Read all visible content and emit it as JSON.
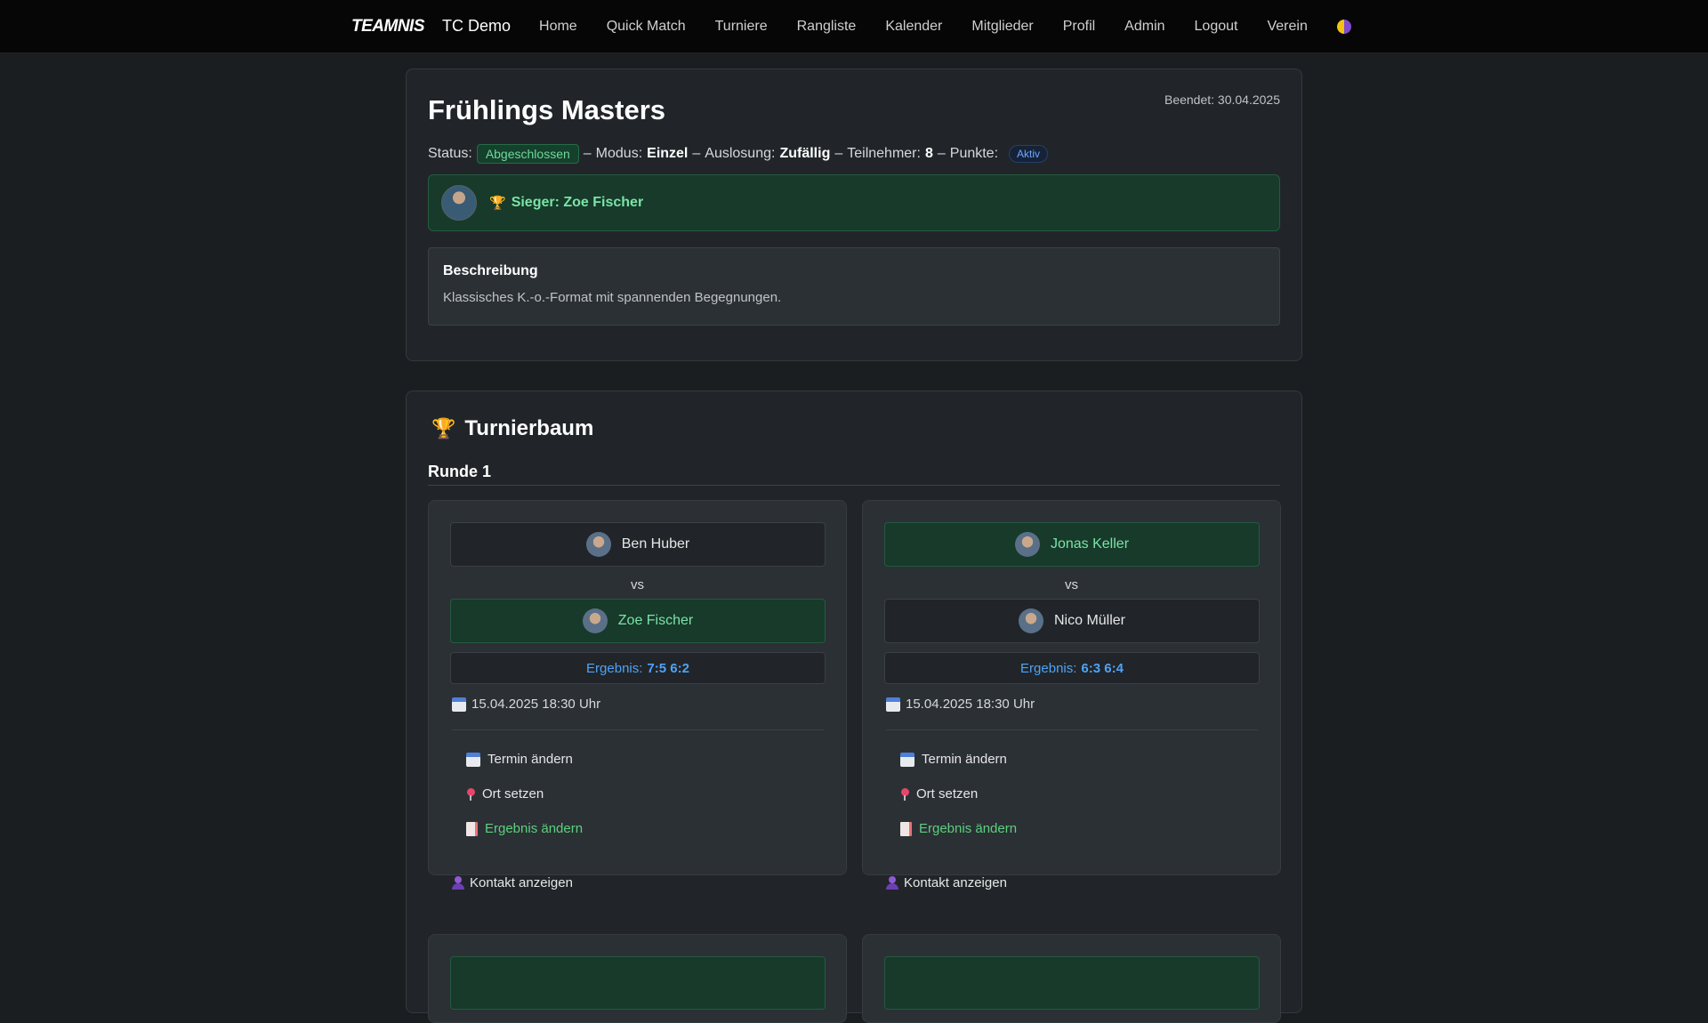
{
  "nav": {
    "logo_text": "TEAMNIS",
    "brand": "TC Demo",
    "items": [
      "Home",
      "Quick Match",
      "Turniere",
      "Rangliste",
      "Kalender",
      "Mitglieder",
      "Profil",
      "Admin",
      "Logout",
      "Verein"
    ]
  },
  "tournament": {
    "title": "Frühlings Masters",
    "ended": "Beendet: 30.04.2025",
    "status_label": "Status:",
    "status": "Abgeschlossen",
    "mode_label": "Modus:",
    "mode": "Einzel",
    "draw_label": "Auslosung:",
    "draw": "Zufällig",
    "participants_label": "Teilnehmer:",
    "participants": "8",
    "points_label": "Punkte:",
    "points_badge": "Aktiv",
    "separator": "–",
    "winner": "Sieger: Zoe Fischer",
    "description_title": "Beschreibung",
    "description": "Klassisches K.-o.-Format mit spannenden Begegnungen."
  },
  "tree": {
    "title": "Turnierbaum",
    "round": "Runde 1",
    "matches": [
      {
        "player1": "Ben Huber",
        "player2": "Zoe Fischer",
        "vs": "vs",
        "result_label": "Ergebnis:",
        "result": "7:5 6:2",
        "date": "15.04.2025 18:30 Uhr",
        "actions": [
          "Termin ändern",
          "Ort setzen",
          "Ergebnis ändern"
        ],
        "contact": "Kontakt anzeigen"
      },
      {
        "player1": "Jonas Keller",
        "player2": "Nico Müller",
        "vs": "vs",
        "result_label": "Ergebnis:",
        "result": "6:3 6:4",
        "date": "15.04.2025 18:30 Uhr",
        "actions": [
          "Termin ändern",
          "Ort setzen",
          "Ergebnis ändern"
        ],
        "contact": "Kontakt anzeigen"
      }
    ]
  },
  "colors": {
    "background": "#1b1e21",
    "card": "#212529",
    "winner_green": "#7be3a7",
    "result_blue": "#4fa3f7"
  }
}
